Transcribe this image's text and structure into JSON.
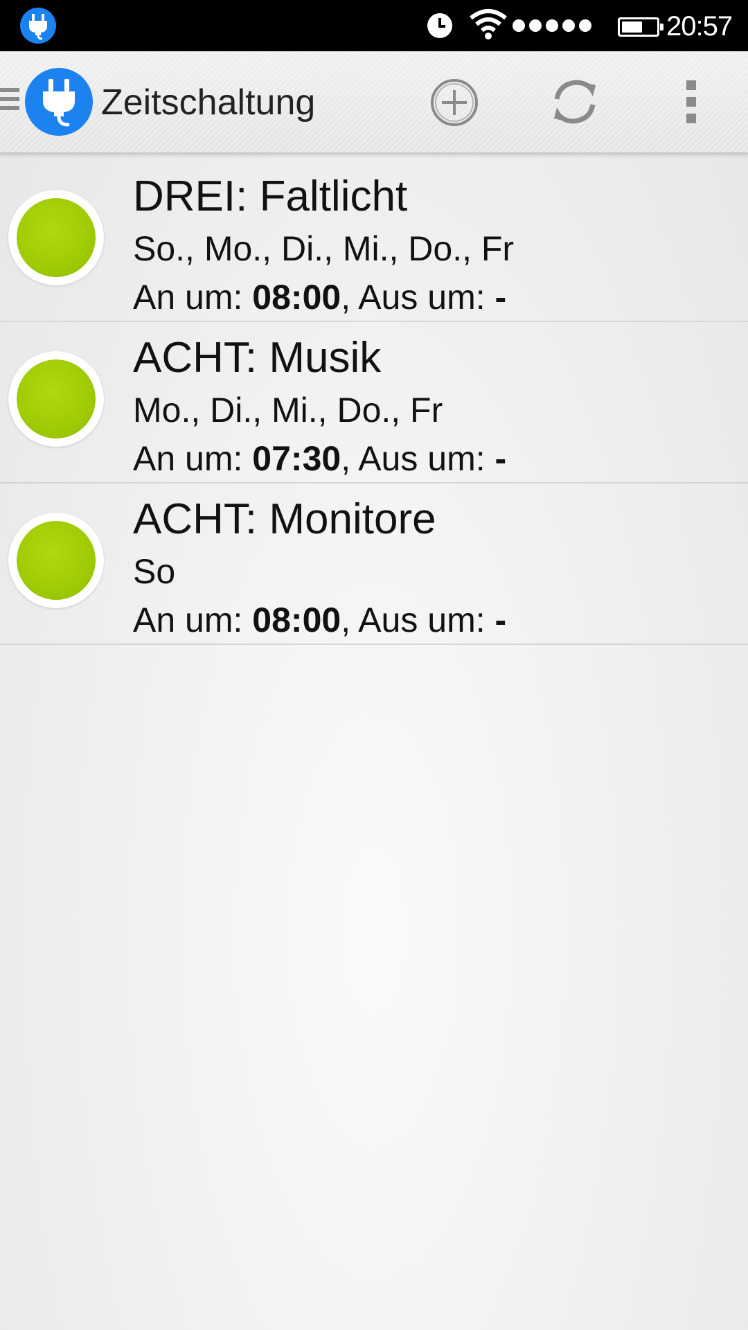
{
  "status_bar": {
    "time": "20:57",
    "icons": [
      "plug-notification-icon",
      "alarm-icon",
      "wifi-icon",
      "signal-dots-icon",
      "battery-icon"
    ],
    "battery_level": 0.6
  },
  "action_bar": {
    "title": "Zeitschaltung",
    "icons": [
      "drawer-icon",
      "plug-logo-icon",
      "add-icon",
      "refresh-icon",
      "overflow-menu-icon"
    ]
  },
  "timers": [
    {
      "title": "DREI: Faltlicht",
      "days": "So., Mo., Di., Mi., Do., Fr",
      "on_label": "An um: ",
      "on_time": "08:00",
      "off_label": ", Aus um: ",
      "off_time": "-",
      "status_color": "#9fcb04"
    },
    {
      "title": "ACHT: Musik",
      "days": "Mo., Di., Mi., Do., Fr",
      "on_label": "An um: ",
      "on_time": "07:30",
      "off_label": ", Aus um: ",
      "off_time": "-",
      "status_color": "#9fcb04"
    },
    {
      "title": "ACHT: Monitore",
      "days": "So",
      "on_label": "An um: ",
      "on_time": "08:00",
      "off_label": ", Aus um: ",
      "off_time": "-",
      "status_color": "#9fcb04"
    }
  ],
  "colors": {
    "brand_blue": "#1b82f0",
    "status_green": "#9fcb04",
    "icon_gray": "#8a8a8a"
  }
}
